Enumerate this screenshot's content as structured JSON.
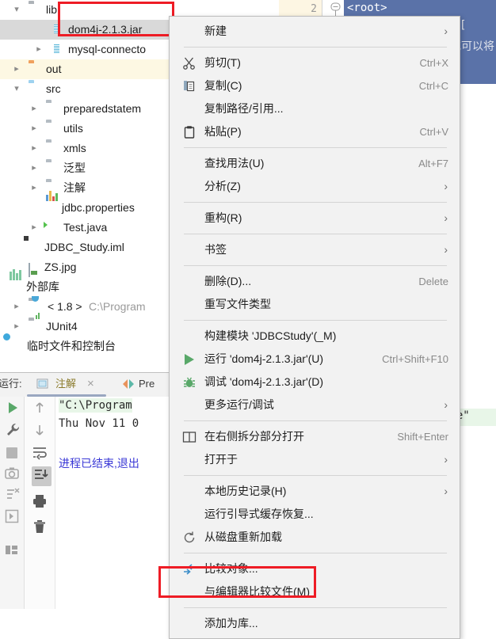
{
  "tree": {
    "items": [
      {
        "label": "lib",
        "icon": "folder-gray-icon",
        "indent": 36,
        "arrow": "v",
        "state": "normal"
      },
      {
        "label": "dom4j-2.1.3.jar",
        "icon": "jar-icon",
        "indent": 66,
        "arrow": "",
        "state": "selected"
      },
      {
        "label": "mysql-connecto",
        "icon": "jar-icon",
        "indent": 66,
        "arrow": ">",
        "state": "normal"
      },
      {
        "label": "out",
        "icon": "folder-orange-icon",
        "indent": 36,
        "arrow": ">",
        "state": "highlight"
      },
      {
        "label": "src",
        "icon": "folder-blue-icon",
        "indent": 36,
        "arrow": "v",
        "state": "normal"
      },
      {
        "label": "preparedstatem",
        "icon": "package-icon",
        "indent": 58,
        "arrow": ">",
        "state": "normal"
      },
      {
        "label": "utils",
        "icon": "package-icon",
        "indent": 58,
        "arrow": ">",
        "state": "normal"
      },
      {
        "label": "xmls",
        "icon": "package-icon",
        "indent": 58,
        "arrow": ">",
        "state": "normal"
      },
      {
        "label": "泛型",
        "icon": "package-icon",
        "indent": 58,
        "arrow": ">",
        "state": "normal"
      },
      {
        "label": "注解",
        "icon": "package-icon",
        "indent": 58,
        "arrow": ">",
        "state": "normal"
      },
      {
        "label": "jdbc.properties",
        "icon": "properties-icon",
        "indent": 58,
        "arrow": "",
        "state": "normal"
      },
      {
        "label": "Test.java",
        "icon": "java-class-icon",
        "indent": 58,
        "arrow": ">",
        "state": "normal"
      },
      {
        "label": "JDBC_Study.iml",
        "icon": "iml-file-icon",
        "indent": 36,
        "arrow": "",
        "state": "normal"
      },
      {
        "label": "ZS.jpg",
        "icon": "image-file-icon",
        "indent": 36,
        "arrow": "",
        "state": "normal"
      },
      {
        "label": "外部库",
        "icon": "external-libraries-icon",
        "indent": 14,
        "arrow": "",
        "state": "normal"
      },
      {
        "label": "< 1.8 >",
        "sublabel": "C:\\Program",
        "icon": "jdk-icon",
        "indent": 36,
        "arrow": ">",
        "state": "normal"
      },
      {
        "label": "JUnit4",
        "icon": "junit-icon",
        "indent": 36,
        "arrow": ">",
        "state": "normal"
      },
      {
        "label": "临时文件和控制台",
        "icon": "scratches-icon",
        "indent": 14,
        "arrow": "",
        "state": "normal"
      }
    ]
  },
  "editor": {
    "line_number": "2",
    "selected_tag": "<root>",
    "selection_text_1": "[",
    "selection_text_2": "或可以将"
  },
  "console": {
    "run_label": "运行:",
    "tab_active": "注解",
    "tab_second": "Pre",
    "close_label": "×",
    "line1": "\"C:\\Program",
    "line2": "Thu Nov 11 0",
    "line3": "进程已结束,退出",
    "right_fragment": "exe\"",
    "toolbar_left": [
      "run-icon",
      "settings-wrench-icon",
      "stop-icon",
      "camera-icon",
      "rerun-failed-icon",
      "step-icon",
      "layout-icon"
    ],
    "toolbar_second": [
      "up-arrow-icon",
      "down-arrow-icon",
      "soft-wrap-icon",
      "scroll-to-end-icon",
      "print-icon",
      "trash-icon"
    ]
  },
  "menu": {
    "items": [
      {
        "label": "新建",
        "accel": "",
        "submenu": true,
        "icon": "",
        "type": "item"
      },
      {
        "type": "separator"
      },
      {
        "label": "剪切(T)",
        "accel": "Ctrl+X",
        "submenu": false,
        "icon": "scissors-icon",
        "type": "item",
        "mnemonic": "T"
      },
      {
        "label": "复制(C)",
        "accel": "Ctrl+C",
        "submenu": false,
        "icon": "copy-icon",
        "type": "item",
        "mnemonic": "C"
      },
      {
        "label": "复制路径/引用...",
        "accel": "",
        "submenu": false,
        "icon": "",
        "type": "item"
      },
      {
        "label": "粘贴(P)",
        "accel": "Ctrl+V",
        "submenu": false,
        "icon": "paste-icon",
        "type": "item",
        "mnemonic": "P"
      },
      {
        "type": "separator"
      },
      {
        "label": "查找用法(U)",
        "accel": "Alt+F7",
        "submenu": false,
        "icon": "",
        "type": "item",
        "mnemonic": "U"
      },
      {
        "label": "分析(Z)",
        "accel": "",
        "submenu": true,
        "icon": "",
        "type": "item",
        "mnemonic": "Z"
      },
      {
        "type": "separator"
      },
      {
        "label": "重构(R)",
        "accel": "",
        "submenu": true,
        "icon": "",
        "type": "item",
        "mnemonic": "R"
      },
      {
        "type": "separator"
      },
      {
        "label": "书签",
        "accel": "",
        "submenu": true,
        "icon": "",
        "type": "item"
      },
      {
        "type": "separator"
      },
      {
        "label": "删除(D)...",
        "accel": "Delete",
        "submenu": false,
        "icon": "",
        "type": "item",
        "mnemonic": "D"
      },
      {
        "label": "重写文件类型",
        "accel": "",
        "submenu": false,
        "icon": "",
        "type": "item"
      },
      {
        "type": "separator"
      },
      {
        "label": "构建模块 'JDBCStudy'(_M)",
        "accel": "",
        "submenu": false,
        "icon": "",
        "type": "item",
        "mnemonic": "S"
      },
      {
        "label": "运行 'dom4j-2.1.3.jar'(U)",
        "accel": "Ctrl+Shift+F10",
        "submenu": false,
        "icon": "run-green-icon",
        "type": "item",
        "mnemonic": "U"
      },
      {
        "label": "调试 'dom4j-2.1.3.jar'(D)",
        "accel": "",
        "submenu": false,
        "icon": "debug-bug-icon",
        "type": "item",
        "mnemonic": "D"
      },
      {
        "label": "更多运行/调试",
        "accel": "",
        "submenu": true,
        "icon": "",
        "type": "item"
      },
      {
        "type": "separator"
      },
      {
        "label": "在右侧拆分部分打开",
        "accel": "Shift+Enter",
        "submenu": false,
        "icon": "split-icon",
        "type": "item"
      },
      {
        "label": "打开于",
        "accel": "",
        "submenu": true,
        "icon": "",
        "type": "item"
      },
      {
        "type": "separator"
      },
      {
        "label": "本地历史记录(H)",
        "accel": "",
        "submenu": true,
        "icon": "",
        "type": "item",
        "mnemonic": "H"
      },
      {
        "label": "运行引导式缓存恢复...",
        "accel": "",
        "submenu": false,
        "icon": "",
        "type": "item"
      },
      {
        "label": "从磁盘重新加载",
        "accel": "",
        "submenu": false,
        "icon": "reload-icon",
        "type": "item"
      },
      {
        "type": "separator"
      },
      {
        "label": "比较对象...",
        "accel": "",
        "submenu": false,
        "icon": "compare-icon",
        "type": "item"
      },
      {
        "label": "与编辑器比较文件(M)",
        "accel": "",
        "submenu": false,
        "icon": "",
        "type": "item",
        "mnemonic": "M"
      },
      {
        "type": "separator"
      },
      {
        "label": "添加为库...",
        "accel": "",
        "submenu": false,
        "icon": "",
        "type": "item",
        "highlighted": true
      }
    ]
  },
  "annotations": {
    "red_box_color": "#ee1c25",
    "selection_color": "#5a72a8",
    "accent_green": "#59a869"
  }
}
